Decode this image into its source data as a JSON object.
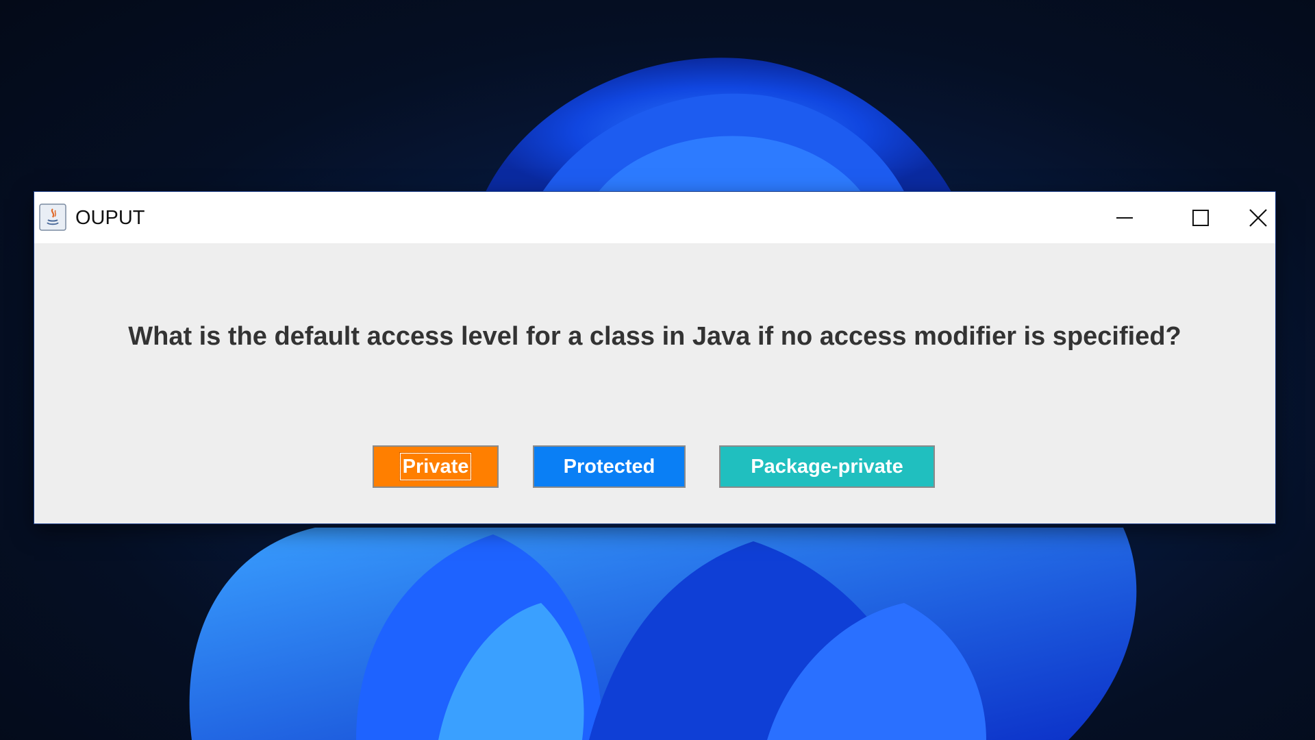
{
  "window": {
    "title": "OUPUT"
  },
  "question": {
    "text": "What is the default access level for a class in Java if no access modifier is specified?"
  },
  "answers": [
    {
      "label": "Private",
      "color": "#ff7f00"
    },
    {
      "label": "Protected",
      "color": "#0a7ff5"
    },
    {
      "label": "Package-private",
      "color": "#20bfbf"
    }
  ],
  "icons": {
    "app": "java-app-icon",
    "minimize": "minimize-icon",
    "maximize": "maximize-icon",
    "close": "close-icon"
  }
}
